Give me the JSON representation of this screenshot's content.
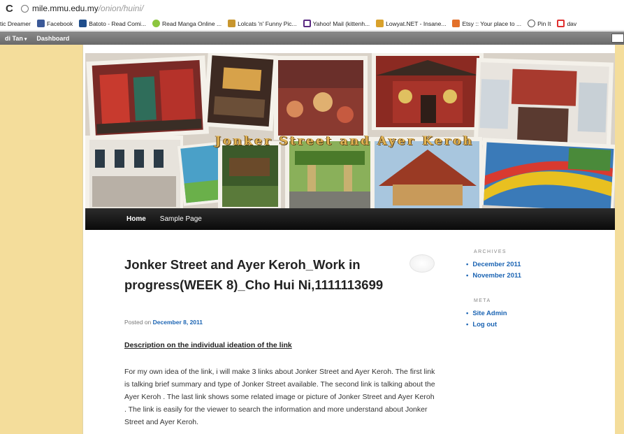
{
  "browser": {
    "reload_icon": "C",
    "url_host": "mile.mmu.edu.my",
    "url_path": "/onion/huini/"
  },
  "bookmarks": [
    {
      "label": "tic Dreamer",
      "icon": "none",
      "color": ""
    },
    {
      "label": "Facebook",
      "icon": "facebook-icon",
      "color": "#3b5998"
    },
    {
      "label": "Batoto - Read Comi...",
      "icon": "batoto-icon",
      "color": "#1f4e8c"
    },
    {
      "label": "Read Manga Online ...",
      "icon": "manga-icon",
      "color": "#8cc63f"
    },
    {
      "label": "Lolcats 'n' Funny Pic...",
      "icon": "lolcats-icon",
      "color": "#c8962e"
    },
    {
      "label": "Yahoo! Mail (kittenh...",
      "icon": "yahoo-icon",
      "color": "#5a2a82"
    },
    {
      "label": "Lowyat.NET - Insane...",
      "icon": "lowyat-icon",
      "color": "#d9a12b"
    },
    {
      "label": "Etsy :: Your place to ...",
      "icon": "etsy-icon",
      "color": "#e3702a"
    },
    {
      "label": "Pin It",
      "icon": "pinit-icon",
      "color": "#555555"
    },
    {
      "label": "dav",
      "icon": "dav-icon",
      "color": "#e03030"
    }
  ],
  "adminbar": {
    "user": "di Tan",
    "dashboard": "Dashboard"
  },
  "header": {
    "banner_text": "Jonker Street and Ayer Keroh"
  },
  "nav": {
    "items": [
      "Home",
      "Sample Page"
    ]
  },
  "post": {
    "title": "Jonker Street and Ayer Keroh_Work in progress(WEEK 8)_Cho Hui Ni,1111113699",
    "posted_prefix": "Posted on",
    "posted_date": "December 8, 2011",
    "section_heading": "Description on the individual ideation of the link",
    "body": "For my own idea of the link, i will make 3 links about Jonker Street and Ayer Keroh. The first link is talking brief summary and type of Jonker Street available. The second link is talking about the Ayer Keroh . The last link shows some related image or picture of Jonker Street and Ayer Keroh . The link is easily for the viewer to search the information and more understand about Jonker Street and Ayer Keroh."
  },
  "sidebar": {
    "archives_title": "ARCHIVES",
    "archives": [
      "December 2011",
      "November 2011"
    ],
    "meta_title": "META",
    "meta": [
      "Site Admin",
      "Log out"
    ]
  },
  "colors": {
    "page_background": "#f4dd9b",
    "link": "#1b64b3",
    "nav_bar": "#111111"
  }
}
